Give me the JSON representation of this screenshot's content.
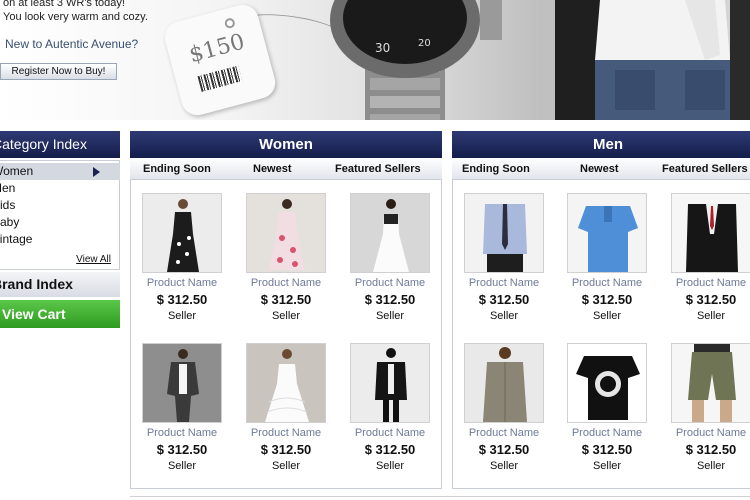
{
  "banner": {
    "line1": "on at least 3 WR's today!",
    "line2": "You look very warm and cozy.",
    "question": "New to Autentic Avenue?",
    "register_label": "Register Now to Buy!",
    "price_tag": "$150"
  },
  "sidebar": {
    "category_title": "Category Index",
    "categories": [
      {
        "label": "Women"
      },
      {
        "label": "Men"
      },
      {
        "label": "Kids"
      },
      {
        "label": "Baby"
      },
      {
        "label": "Vintage"
      }
    ],
    "view_all": "View All",
    "brand_title": "Brand Index",
    "cart_label": "View Cart"
  },
  "panels": [
    {
      "title": "Women",
      "tabs": [
        "Ending Soon",
        "Newest",
        "Featured Sellers"
      ],
      "products": [
        {
          "name": "Product Name",
          "price": "$ 312.50",
          "seller": "Seller",
          "icon": "dress-black-floral"
        },
        {
          "name": "Product Name",
          "price": "$ 312.50",
          "seller": "Seller",
          "icon": "dress-pink-floral"
        },
        {
          "name": "Product Name",
          "price": "$ 312.50",
          "seller": "Seller",
          "icon": "dress-white"
        },
        {
          "name": "Product Name",
          "price": "$ 312.50",
          "seller": "Seller",
          "icon": "cardigan-grey"
        },
        {
          "name": "Product Name",
          "price": "$ 312.50",
          "seller": "Seller",
          "icon": "dress-white-ruffle"
        },
        {
          "name": "Product Name",
          "price": "$ 312.50",
          "seller": "Seller",
          "icon": "jacket-black"
        }
      ]
    },
    {
      "title": "Men",
      "tabs": [
        "Ending Soon",
        "Newest",
        "Featured Sellers"
      ],
      "products": [
        {
          "name": "Product Name",
          "price": "$ 312.50",
          "seller": "Seller",
          "icon": "shirt-tie"
        },
        {
          "name": "Product Name",
          "price": "$ 312.50",
          "seller": "Seller",
          "icon": "polo-blue"
        },
        {
          "name": "Product Name",
          "price": "$ 312.50",
          "seller": "Seller",
          "icon": "suit-black"
        },
        {
          "name": "Product Name",
          "price": "$ 312.50",
          "seller": "Seller",
          "icon": "trench-coat"
        },
        {
          "name": "Product Name",
          "price": "$ 312.50",
          "seller": "Seller",
          "icon": "tshirt-black"
        },
        {
          "name": "Product Name",
          "price": "$ 312.50",
          "seller": "Seller",
          "icon": "shorts-khaki"
        }
      ]
    }
  ],
  "colors": {
    "header_navy": "#1c2658",
    "cart_green": "#3fae2c",
    "product_name": "#6d7a98"
  }
}
